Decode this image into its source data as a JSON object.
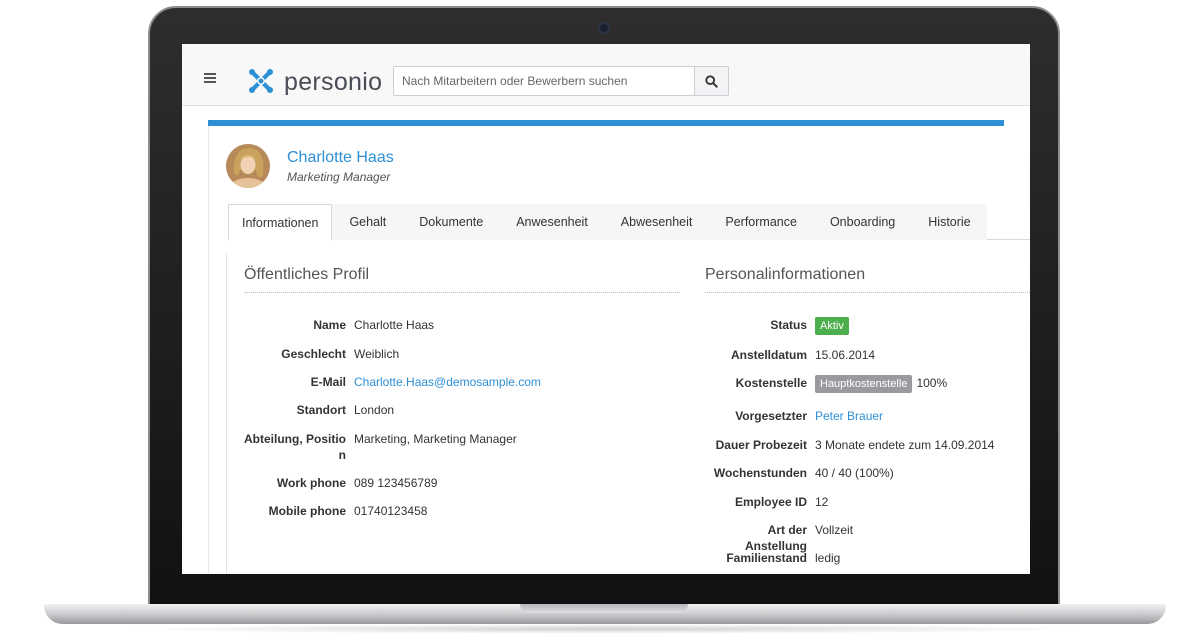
{
  "header": {
    "logo_text": "personio",
    "search_placeholder": "Nach Mitarbeitern oder Bewerbern suchen"
  },
  "profile": {
    "name": "Charlotte Haas",
    "title": "Marketing Manager"
  },
  "tabs": [
    {
      "label": "Informationen",
      "active": true
    },
    {
      "label": "Gehalt"
    },
    {
      "label": "Dokumente"
    },
    {
      "label": "Anwesenheit"
    },
    {
      "label": "Abwesenheit"
    },
    {
      "label": "Performance"
    },
    {
      "label": "Onboarding"
    },
    {
      "label": "Historie"
    }
  ],
  "public_profile": {
    "heading": "Öffentliches Profil",
    "fields": [
      {
        "label": "Name",
        "value": "Charlotte Haas"
      },
      {
        "label": "Geschlecht",
        "value": "Weiblich"
      },
      {
        "label": "E-Mail",
        "value": "Charlotte.Haas@demosample.com"
      },
      {
        "label": "Standort",
        "value": "London"
      },
      {
        "label": "Abteilung, Position",
        "value": "Marketing, Marketing Manager"
      },
      {
        "label": "Work phone",
        "value": "089 123456789"
      },
      {
        "label": "Mobile phone",
        "value": "01740123458"
      }
    ]
  },
  "personal_info": {
    "heading": "Personalinformationen",
    "fields": [
      {
        "label": "Status",
        "value": "Aktiv"
      },
      {
        "label": "Anstelldatum",
        "value": "15.06.2014"
      },
      {
        "label": "Kostenstelle",
        "badge": "Hauptkostenstelle",
        "value": "100%"
      },
      {
        "label": "Vorgesetzter",
        "value": "Peter Brauer"
      },
      {
        "label": "Dauer Probezeit",
        "value": "3 Monate endete zum 14.09.2014"
      },
      {
        "label": "Wochenstunden",
        "value": "40 / 40 (100%)"
      },
      {
        "label": "Employee ID",
        "value": "12"
      },
      {
        "label": "Art der Anstellung",
        "value": "Vollzeit"
      },
      {
        "label": "Familienstand",
        "value": "ledig"
      }
    ]
  },
  "colors": {
    "accent": "#2d8fd6",
    "status_active": "#4cae4c",
    "badge_gray": "#9a9a9e"
  },
  "icons": [
    "hamburger-icon",
    "personio-logo-icon",
    "search-icon"
  ]
}
